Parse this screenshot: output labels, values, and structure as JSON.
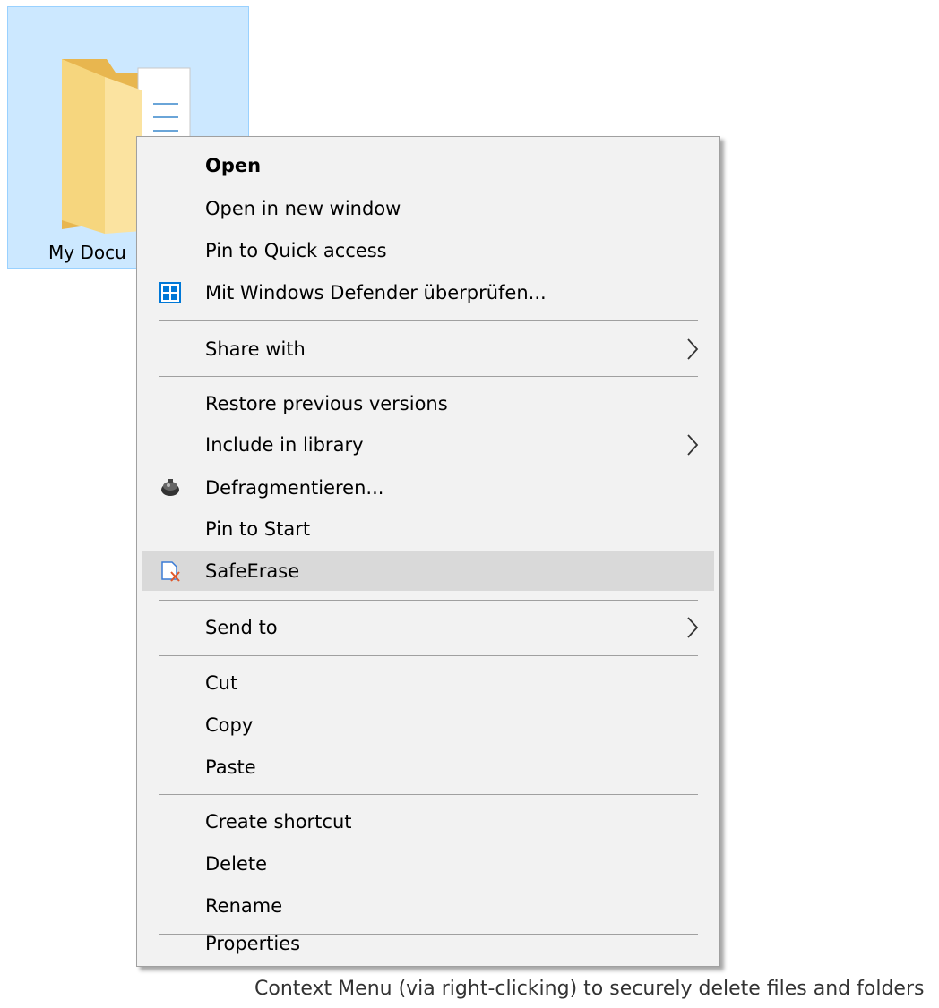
{
  "desktop": {
    "folder_label": "My Docu"
  },
  "context_menu": {
    "items": [
      {
        "label": "Open",
        "bold": true
      },
      {
        "label": "Open in new window"
      },
      {
        "label": "Pin to Quick access"
      },
      {
        "label": "Mit Windows Defender überprüfen...",
        "icon": "windows-defender-shield-icon"
      },
      {
        "label": "Share with",
        "submenu": true
      },
      {
        "label": "Restore previous versions"
      },
      {
        "label": "Include in library",
        "submenu": true
      },
      {
        "label": "Defragmentieren...",
        "icon": "defrag-icon"
      },
      {
        "label": "Pin to Start"
      },
      {
        "label": "SafeErase",
        "icon": "safeerase-icon",
        "highlighted": true
      },
      {
        "label": "Send to",
        "submenu": true
      },
      {
        "label": "Cut"
      },
      {
        "label": "Copy"
      },
      {
        "label": "Paste"
      },
      {
        "label": "Create shortcut"
      },
      {
        "label": "Delete"
      },
      {
        "label": "Rename"
      },
      {
        "label": "Properties"
      }
    ],
    "highlight_color": "#d9d9d9",
    "background_color": "#f2f2f2"
  },
  "caption": "Context Menu (via right-clicking) to securely delete files and folders",
  "colors": {
    "selection_fill": "#cce8ff",
    "selection_border": "#99d1ff",
    "defender_blue": "#0078d7"
  }
}
